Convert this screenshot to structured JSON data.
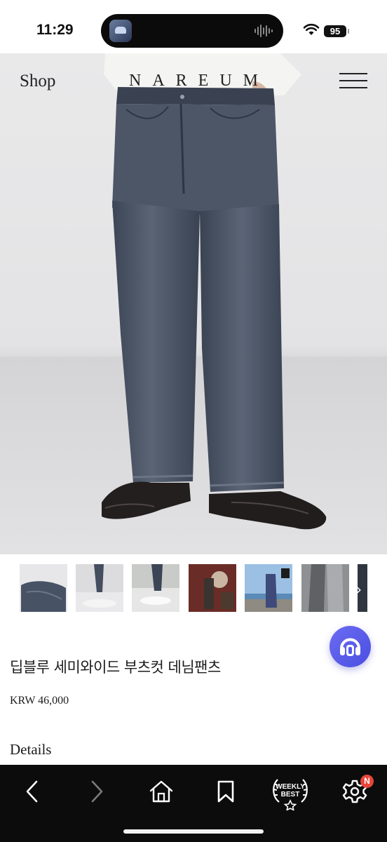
{
  "status_bar": {
    "time": "11:29",
    "battery": "95"
  },
  "header": {
    "shop_label": "Shop",
    "logo": "NAREUM",
    "menu_icon": "hamburger-menu-icon"
  },
  "hero": {
    "image": "model wearing dark washed blue semi-wide bootcut jeans"
  },
  "thumbnails": [
    "jeans-detail-1",
    "jeans-detail-2",
    "jeans-detail-3",
    "jeans-detail-4",
    "jeans-detail-5",
    "jeans-detail-6",
    "jeans-detail-7"
  ],
  "product": {
    "title": "딥블루 세미와이드 부츠컷 데님팬츠",
    "price": "KRW 46,000",
    "details_label": "Details"
  },
  "chat_fab": {
    "icon": "headset-icon",
    "color": "#5558ea"
  },
  "toolbar": {
    "items": [
      "back-icon",
      "forward-icon",
      "home-icon",
      "bookmark-icon",
      "weekly-best-icon",
      "settings-icon"
    ],
    "weekly_line1": "WEEKLY",
    "weekly_line2": "BEST",
    "settings_badge": "N"
  },
  "colors": {
    "toolbar_bg": "#0c0c0c",
    "badge": "#e8463a",
    "denim": "#4a5566"
  }
}
